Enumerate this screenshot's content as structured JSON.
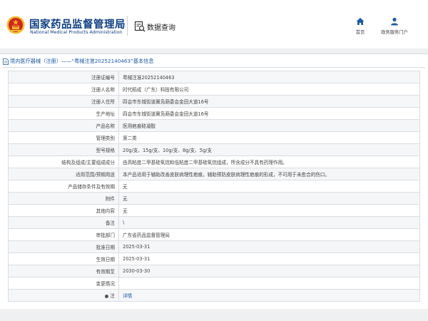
{
  "header": {
    "logo_cn": "国家药品监督管理局",
    "logo_en": "National Medical Products Administration",
    "section_title": "数据查询",
    "nav": [
      {
        "label": "首页",
        "icon": "home-icon"
      },
      {
        "label": "政务服务门户",
        "icon": "user-icon"
      }
    ]
  },
  "breadcrumb": {
    "text": "境内医疗器械（注册）——“粤械注准20252140463”基本信息"
  },
  "detail": {
    "rows": [
      {
        "key": "注册证编号",
        "value": "粤械注准20252140463"
      },
      {
        "key": "注册人名称",
        "value": "时代稻成（广东）科技有限公司"
      },
      {
        "key": "注册人住所",
        "value": "四会市东城街道冀凫荫委会金田大道16号"
      },
      {
        "key": "生产地址",
        "value": "四会市东城街道冀凫荫委会金田大道16号"
      },
      {
        "key": "产品名称",
        "value": "医用疤痕硅凝胶"
      },
      {
        "key": "管理类别",
        "value": "第二类"
      },
      {
        "key": "型号规格",
        "value": "20g/支、15g/支、10g/支、8g/支、5g/支"
      },
      {
        "key": "结构及组成/主要组成成分",
        "value": "由高粘度二甲基硅氧烷和低粘度二甲基硅氧烷组成，所含成分不具有药理作用。"
      },
      {
        "key": "适用范围/预期用途",
        "value": "本产品适用于辅助改善皮肤病理性疤痕，辅助预防皮肤病理性疤痕的形成，不可用于未愈合的伤口。"
      },
      {
        "key": "产品储存条件及有效期",
        "value": "无"
      },
      {
        "key": "附件",
        "value": "无"
      },
      {
        "key": "其他内容",
        "value": "无"
      },
      {
        "key": "备注",
        "value": "\\"
      },
      {
        "key": "审批部门",
        "value": "广东省药品监督管理局"
      },
      {
        "key": "批准日期",
        "value": "2025-03-31"
      },
      {
        "key": "生效日期",
        "value": "2025-03-31"
      },
      {
        "key": "有效期至",
        "value": "2030-03-30"
      },
      {
        "key": "变更情况",
        "value": ""
      }
    ],
    "last_row": {
      "key": "注",
      "value": "详情"
    }
  },
  "colors": {
    "brand": "#0e3f85",
    "link": "#1e5aa8",
    "emblem_red": "#d2261e",
    "emblem_gold": "#f2c12e"
  }
}
